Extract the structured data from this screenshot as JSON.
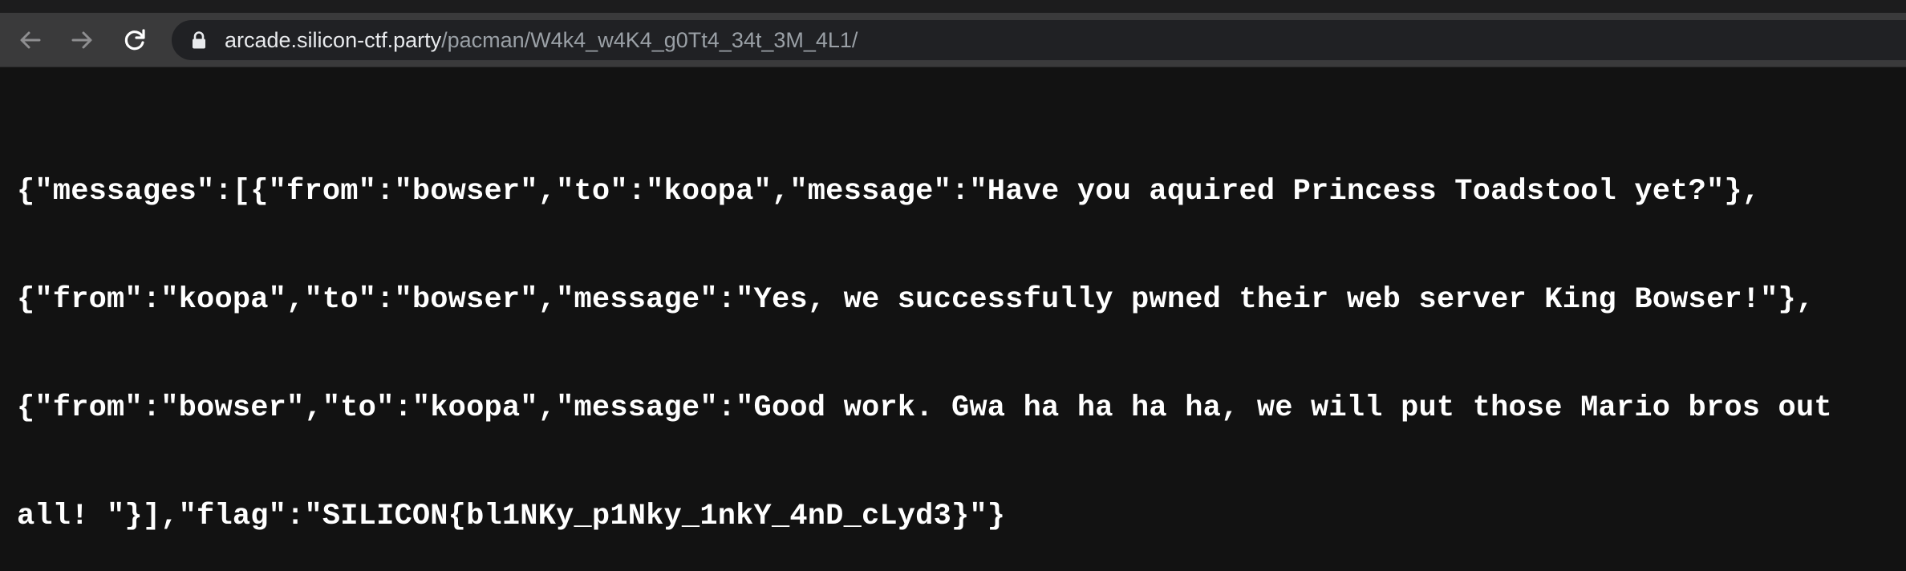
{
  "browser": {
    "url_host": "arcade.silicon-ctf.party",
    "url_path": "/pacman/W4k4_w4K4_g0Tt4_34t_3M_4L1/",
    "icons": {
      "back": "arrow-left-icon",
      "forward": "arrow-right-icon",
      "reload": "reload-icon",
      "lock": "lock-icon"
    }
  },
  "page": {
    "lines": [
      "{\"messages\":[{\"from\":\"bowser\",\"to\":\"koopa\",\"message\":\"Have you aquired Princess Toadstool yet?\"},",
      "{\"from\":\"koopa\",\"to\":\"bowser\",\"message\":\"Yes, we successfully pwned their web server King Bowser!\"},",
      "{\"from\":\"bowser\",\"to\":\"koopa\",\"message\":\"Good work. Gwa ha ha ha ha, we will put those Mario bros out",
      "all! \"}],\"flag\":\"SILICON{bl1NKy_p1Nky_1nkY_4nD_cLyd3}\"}"
    ]
  }
}
